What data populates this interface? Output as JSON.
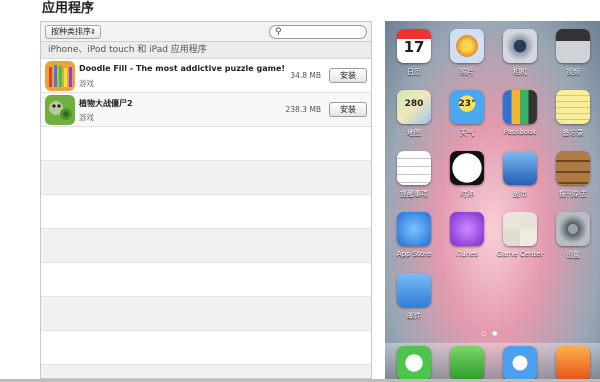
{
  "header": {
    "title": "应用程序"
  },
  "toolbar": {
    "sort_label": "按种类排序",
    "sort_arrow": "⇕",
    "search_placeholder": ""
  },
  "section": {
    "label": "iPhone、iPod touch 和 iPad 应用程序"
  },
  "apps": [
    {
      "name": "Doodle Fill - The most addictive puzzle game!",
      "category": "游戏",
      "size": "34.8 MB",
      "action": "安装"
    },
    {
      "name": "植物大战僵尸2",
      "category": "游戏",
      "size": "238.3 MB",
      "action": "安装"
    }
  ],
  "phone": {
    "icons": [
      {
        "label": "日历",
        "icon": "calendar-icon",
        "text": "17"
      },
      {
        "label": "照片",
        "icon": "photos-icon",
        "text": ""
      },
      {
        "label": "相机",
        "icon": "camera-icon",
        "text": ""
      },
      {
        "label": "视频",
        "icon": "videos-icon",
        "text": ""
      },
      {
        "label": "地图",
        "icon": "maps-icon",
        "text": "280"
      },
      {
        "label": "天气",
        "icon": "weather-icon",
        "text": "23°"
      },
      {
        "label": "Passbook",
        "icon": "passbook-icon",
        "text": ""
      },
      {
        "label": "备忘录",
        "icon": "notes-icon",
        "text": ""
      },
      {
        "label": "提醒事项",
        "icon": "reminders-icon",
        "text": ""
      },
      {
        "label": "时钟",
        "icon": "clock-icon",
        "text": ""
      },
      {
        "label": "股市",
        "icon": "stocks-icon",
        "text": ""
      },
      {
        "label": "报刊杂志",
        "icon": "newsstand-icon",
        "text": ""
      },
      {
        "label": "App Store",
        "icon": "appstore-icon",
        "text": ""
      },
      {
        "label": "iTunes",
        "icon": "itunes-icon",
        "text": ""
      },
      {
        "label": "Game Center",
        "icon": "gamecenter-icon",
        "text": ""
      },
      {
        "label": "设置",
        "icon": "settings-icon",
        "text": ""
      },
      {
        "label": "邮件",
        "icon": "mail-icon",
        "text": ""
      }
    ],
    "page_dots": "○ ●",
    "dock": [
      {
        "icon": "messages-icon"
      },
      {
        "icon": "phone-icon"
      },
      {
        "icon": "safari-icon"
      },
      {
        "icon": "music-icon"
      }
    ]
  }
}
